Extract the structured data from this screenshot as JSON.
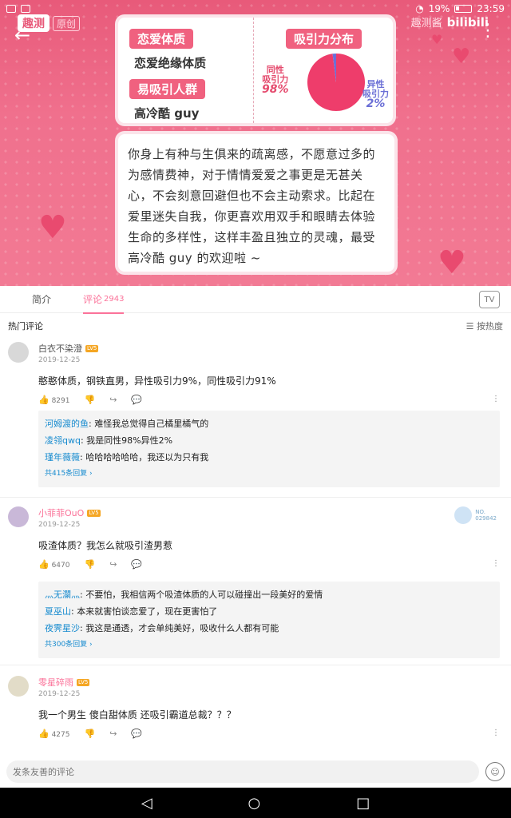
{
  "status": {
    "battery": "19%",
    "time": "23:59"
  },
  "banner": {
    "brand": "趣测",
    "brand_sub": "原创",
    "watermark": "趣测酱",
    "watermark_bili": "bilibili",
    "left_tag_1": "恋爱体质",
    "left_val_1": "恋爱绝缘体质",
    "left_tag_2": "易吸引人群",
    "left_val_2": "高冷酷 guy",
    "right_tag": "吸引力分布",
    "same_label": "同性\n吸引力",
    "same_pct": "98%",
    "diff_label": "异性\n吸引力",
    "diff_pct": "2%",
    "description": "你身上有种与生俱来的疏离感，不愿意过多的为感情费神，对于情情爱爱之事更是无甚关心，不会刻意回避但也不会主动索求。比起在爱里迷失自我，你更喜欢用双手和眼睛去体验生命的多样性，这样丰盈且独立的灵魂，最受高冷酷 guy 的欢迎啦 ~"
  },
  "chart_data": {
    "type": "pie",
    "title": "吸引力分布",
    "categories": [
      "同性吸引力",
      "异性吸引力"
    ],
    "values": [
      98,
      2
    ],
    "colors": [
      "#ee3d6b",
      "#6b6fd6"
    ]
  },
  "tabs": [
    {
      "label": "简介",
      "count": ""
    },
    {
      "label": "评论",
      "count": "2943"
    }
  ],
  "hot_label": "热门评论",
  "sort_label": "按热度",
  "comments": [
    {
      "name": "白衣不染澄",
      "level": "LV5",
      "date": "2019-12-25",
      "text": "憨憨体质，钢铁直男，异性吸引力9%，同性吸引力91%",
      "likes": "8291",
      "replies": [
        {
          "name": "河姆渡的鱼",
          "text": ": 难怪我总觉得自己橘里橘气的"
        },
        {
          "name": "凌翎qwq",
          "text": ": 我是同性98%异性2%"
        },
        {
          "name": "瑾年薇薇",
          "text": ": 哈哈哈哈哈哈，我还以为只有我"
        }
      ],
      "reply_more": "共415条回复"
    },
    {
      "name": "小菲菲OuO",
      "level": "LV5",
      "date": "2019-12-25",
      "text": "吸渣体质？我怎么就吸引渣男惹",
      "likes": "6470",
      "badge": "NO.\n029842",
      "replies": [
        {
          "name": "灬无灁灬",
          "text": ": 不要怕，我相信两个吸渣体质的人可以碰撞出一段美好的爱情"
        },
        {
          "name": "夏巫山",
          "text": ": 本来就害怕谈恋爱了，现在更害怕了"
        },
        {
          "name": "夜霁星沙",
          "text": ": 我这是通透，才会单纯美好，吸收什么人都有可能"
        }
      ],
      "reply_more": "共300条回复"
    },
    {
      "name": "零星碎雨",
      "level": "LV5",
      "date": "2019-12-25",
      "text": "我一个男生 傻白甜体质 还吸引霸道总裁？？？",
      "likes": "4275"
    }
  ],
  "input_placeholder": "发条友善的评论"
}
